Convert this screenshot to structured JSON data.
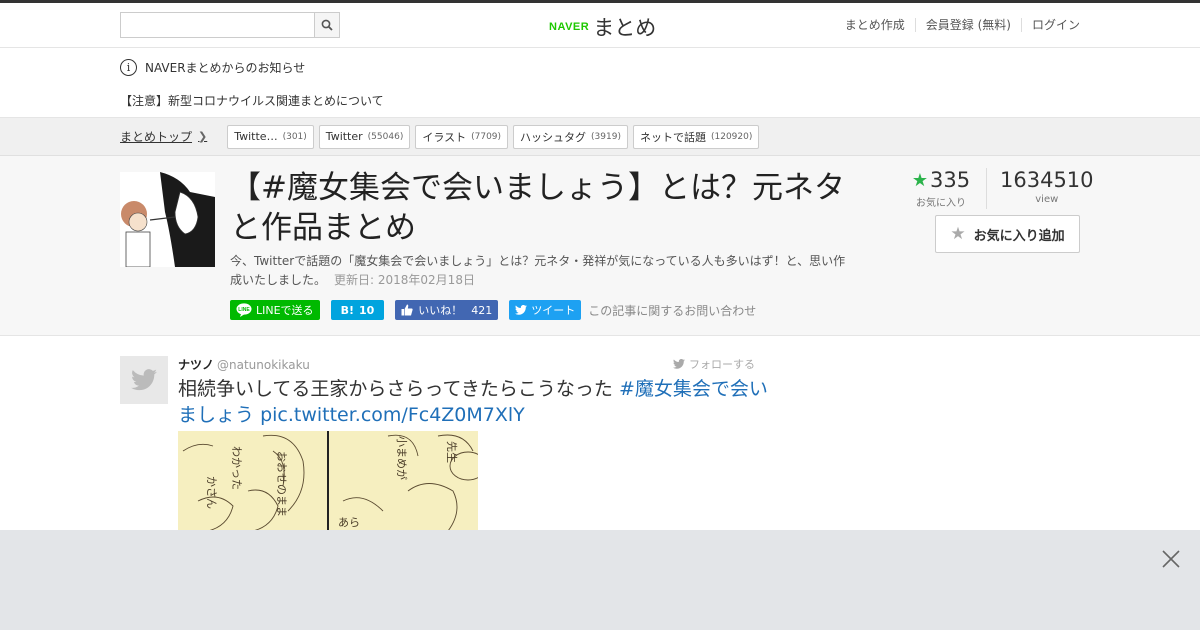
{
  "header": {
    "search_placeholder": "",
    "logo_brand": "NAVER",
    "logo_name": "まとめ",
    "nav": [
      "まとめ作成",
      "会員登録 (無料)",
      "ログイン"
    ]
  },
  "notice": {
    "heading": "NAVERまとめからのお知らせ",
    "item": "【注意】新型コロナウイルス関連まとめについて"
  },
  "breadcrumb": {
    "top": "まとめトップ",
    "tags": [
      {
        "label": "Twitte…",
        "count": "(301)"
      },
      {
        "label": "Twitter",
        "count": "(55046)"
      },
      {
        "label": "イラスト",
        "count": "(7709)"
      },
      {
        "label": "ハッシュタグ",
        "count": "(3919)"
      },
      {
        "label": "ネットで話題",
        "count": "(120920)"
      }
    ]
  },
  "article": {
    "title": "【#魔女集会で会いましょう】とは？元ネタと作品まとめ",
    "description": "今、Twitterで話題の「魔女集会で会いましょう」とは？元ネタ・発祥が気になっている人も多いはず！と、思い作成いたしました。",
    "updated": "更新日: 2018年02月18日",
    "favorites": "335",
    "favorites_label": "お気に入り",
    "views": "1634510",
    "views_label": "view",
    "fav_button": "お気に入り追加"
  },
  "share": {
    "line": "LINEで送る",
    "hatena": "10",
    "facebook_label": "いいね！",
    "facebook_count": "421",
    "tweet": "ツイート",
    "inquiry": "この記事に関するお問い合わせ"
  },
  "tweet": {
    "name": "ナツノ",
    "handle": "@natunokikaku",
    "follow": "フォローする",
    "text": "相続争いしてる王家からさらってきたらこうなった ",
    "hashtag": "#魔女集会で会いましょう",
    "pic_link": "pic.twitter.com/Fc4Z0M7XlY"
  },
  "colors": {
    "naver_green": "#1ec800",
    "star_green": "#2bb34b",
    "line_green": "#00b900",
    "hatena_blue": "#00a4de",
    "facebook_blue": "#4267b2",
    "twitter_blue": "#1da1f2",
    "link_blue": "#1f6fb8"
  }
}
